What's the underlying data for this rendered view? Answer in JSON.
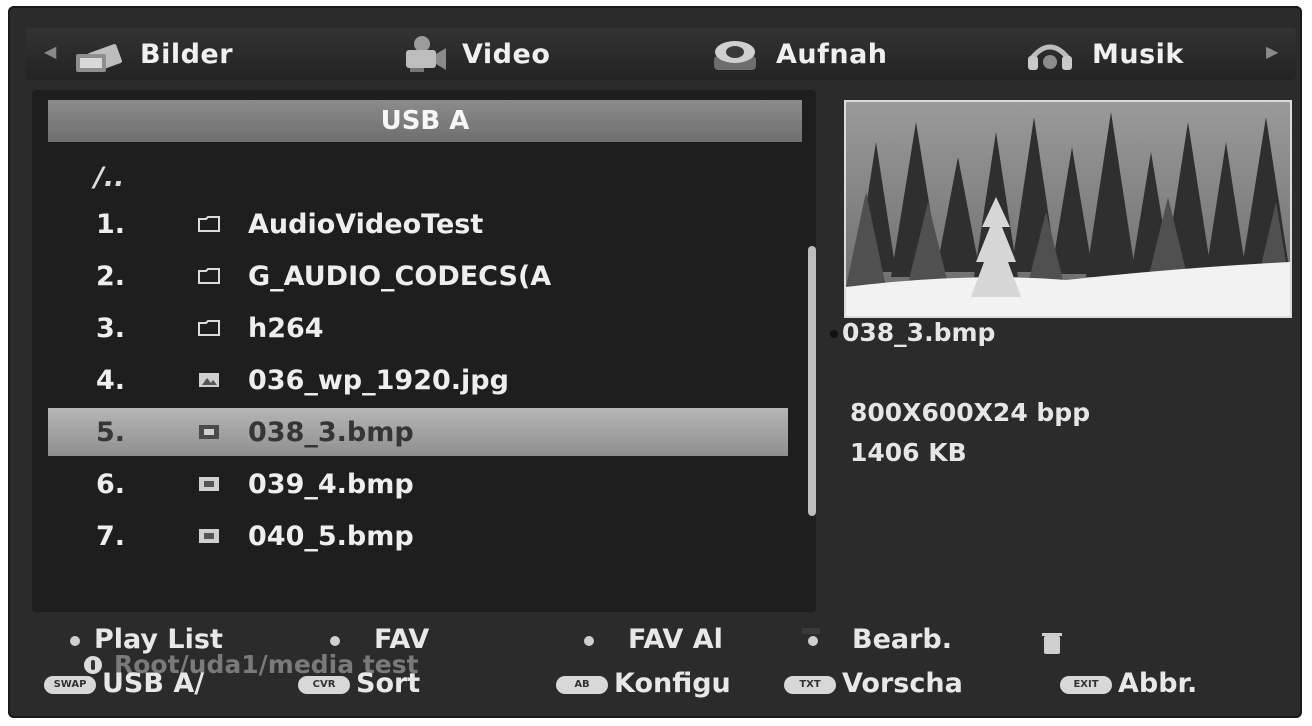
{
  "menu": {
    "items": [
      {
        "label": "Bilder",
        "icon": "pictures-icon"
      },
      {
        "label": "Video",
        "icon": "video-camera-icon"
      },
      {
        "label": "Aufnah",
        "icon": "record-icon"
      },
      {
        "label": "Musik",
        "icon": "music-icon"
      }
    ]
  },
  "list": {
    "header": "USB A",
    "parent": "/..",
    "selected_index": 4,
    "items": [
      {
        "num": "1.",
        "type": "folder",
        "name": "AudioVideoTest"
      },
      {
        "num": "2.",
        "type": "folder",
        "name": "G_AUDIO_CODECS(A"
      },
      {
        "num": "3.",
        "type": "folder",
        "name": "h264"
      },
      {
        "num": "4.",
        "type": "image",
        "name": "036_wp_1920.jpg"
      },
      {
        "num": "5.",
        "type": "image",
        "name": "038_3.bmp"
      },
      {
        "num": "6.",
        "type": "image",
        "name": "039_4.bmp"
      },
      {
        "num": "7.",
        "type": "image",
        "name": "040_5.bmp"
      }
    ],
    "path": "Root/uda1/media test"
  },
  "preview": {
    "filename": "038_3.bmp",
    "resolution": "800X600X24 bpp",
    "size": "1406 KB"
  },
  "legend": {
    "row1": [
      {
        "label": "Play List"
      },
      {
        "label": "FAV"
      },
      {
        "label": "FAV Al"
      },
      {
        "label": "Bearb."
      }
    ],
    "row2": [
      {
        "key": "SWAP",
        "label": "USB A/"
      },
      {
        "key": "CVR",
        "label": "Sort"
      },
      {
        "key": "AB",
        "label": "Konfigu"
      },
      {
        "key": "TXT",
        "label": "Vorscha"
      },
      {
        "key": "EXIT",
        "label": "Abbr."
      }
    ]
  }
}
